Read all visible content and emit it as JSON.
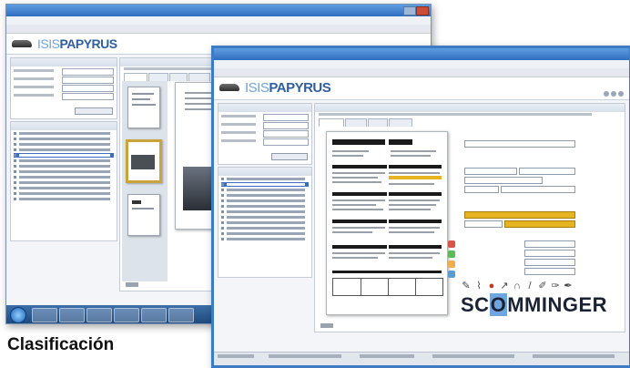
{
  "caption": "Clasificación",
  "back_window": {
    "logo_iso": "ISIS",
    "logo_brand": "PAPYRUS"
  },
  "front_window": {
    "logo_iso": "ISIS",
    "logo_brand": "PAPYRUS",
    "signature": {
      "part1": "SC",
      "part2": "O",
      "part3": "MMINGER"
    }
  },
  "colors": {
    "accent_blue": "#3d7bc7",
    "selected_thumbnail": "#c9a43a",
    "highlight_field": "#e7b421"
  }
}
